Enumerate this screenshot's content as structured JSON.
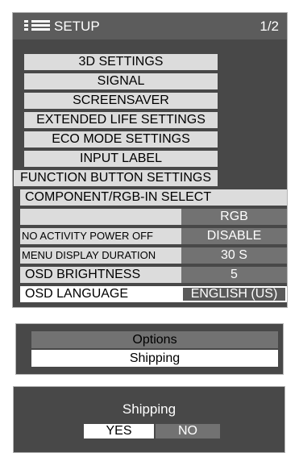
{
  "setup": {
    "title": "SETUP",
    "page": "1/2",
    "menu_items": [
      "3D SETTINGS",
      "SIGNAL",
      "SCREENSAVER",
      "EXTENDED LIFE SETTINGS",
      "ECO MODE SETTINGS",
      "INPUT LABEL",
      "FUNCTION BUTTON SETTINGS"
    ],
    "component_select": {
      "label": "COMPONENT/RGB-IN SELECT",
      "value": "RGB"
    },
    "no_activity_power_off": {
      "label": "NO ACTIVITY POWER OFF",
      "value": "DISABLE"
    },
    "menu_display_duration": {
      "label": "MENU DISPLAY DURATION",
      "value": "30 S"
    },
    "osd_brightness": {
      "label": "OSD BRIGHTNESS",
      "value": "5"
    },
    "osd_language": {
      "label": "OSD LANGUAGE",
      "value": "ENGLISH (US)"
    }
  },
  "options_menu": {
    "items": [
      "Options",
      "Shipping"
    ],
    "selected": "Shipping"
  },
  "confirm_dialog": {
    "title": "Shipping",
    "yes_label": "YES",
    "no_label": "NO",
    "selected": "YES"
  },
  "colors": {
    "panel_bg": "#484848",
    "item_bg": "#dcdcdc",
    "value_bg": "#727272",
    "highlight": "#ffffff"
  },
  "icons": {
    "setup_menu": "menu-list-icon"
  }
}
